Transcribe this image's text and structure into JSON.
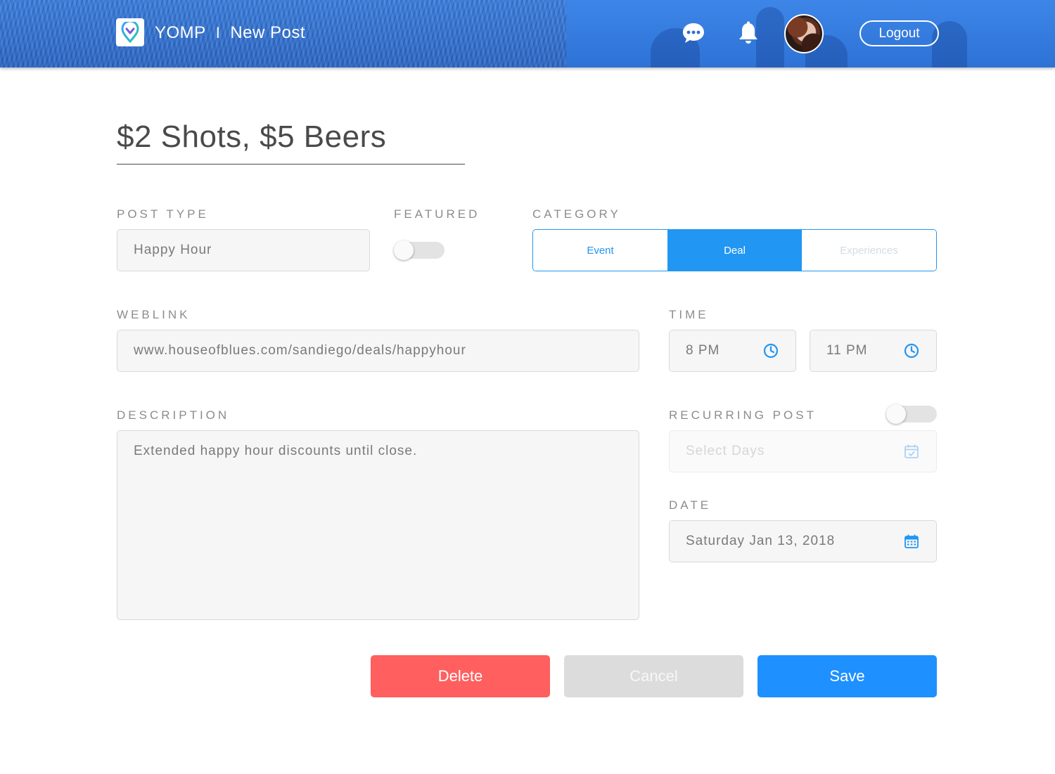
{
  "header": {
    "app_name": "YOMP",
    "separator": "I",
    "page_name": "New Post",
    "logo_icon": "yomp-logo-icon",
    "chat_icon": "chat-bubble-icon",
    "bell_icon": "bell-icon",
    "logout_label": "Logout"
  },
  "post": {
    "title": "$2 Shots, $5 Beers"
  },
  "form": {
    "post_type": {
      "label": "POST TYPE",
      "value": "Happy Hour"
    },
    "featured": {
      "label": "FEATURED",
      "on": false
    },
    "category": {
      "label": "CATEGORY",
      "options": [
        "Event",
        "Deal",
        "Experiences"
      ],
      "selected": "Deal"
    },
    "weblink": {
      "label": "WEBLINK",
      "value": "www.houseofblues.com/sandiego/deals/happyhour"
    },
    "time": {
      "label": "TIME",
      "start": "8 PM",
      "end": "11 PM",
      "icon": "clock-icon"
    },
    "description": {
      "label": "DESCRIPTION",
      "value": "Extended happy hour discounts until close."
    },
    "recurring": {
      "label": "RECURRING POST",
      "on": false,
      "placeholder": "Select Days",
      "icon": "calendar-check-icon"
    },
    "date": {
      "label": "DATE",
      "value": "Saturday Jan 13, 2018",
      "icon": "calendar-icon"
    }
  },
  "actions": {
    "delete_label": "Delete",
    "cancel_label": "Cancel",
    "save_label": "Save"
  },
  "colors": {
    "accent": "#2196f3",
    "danger": "#ff5f5f",
    "header": "#2f6fd1"
  }
}
